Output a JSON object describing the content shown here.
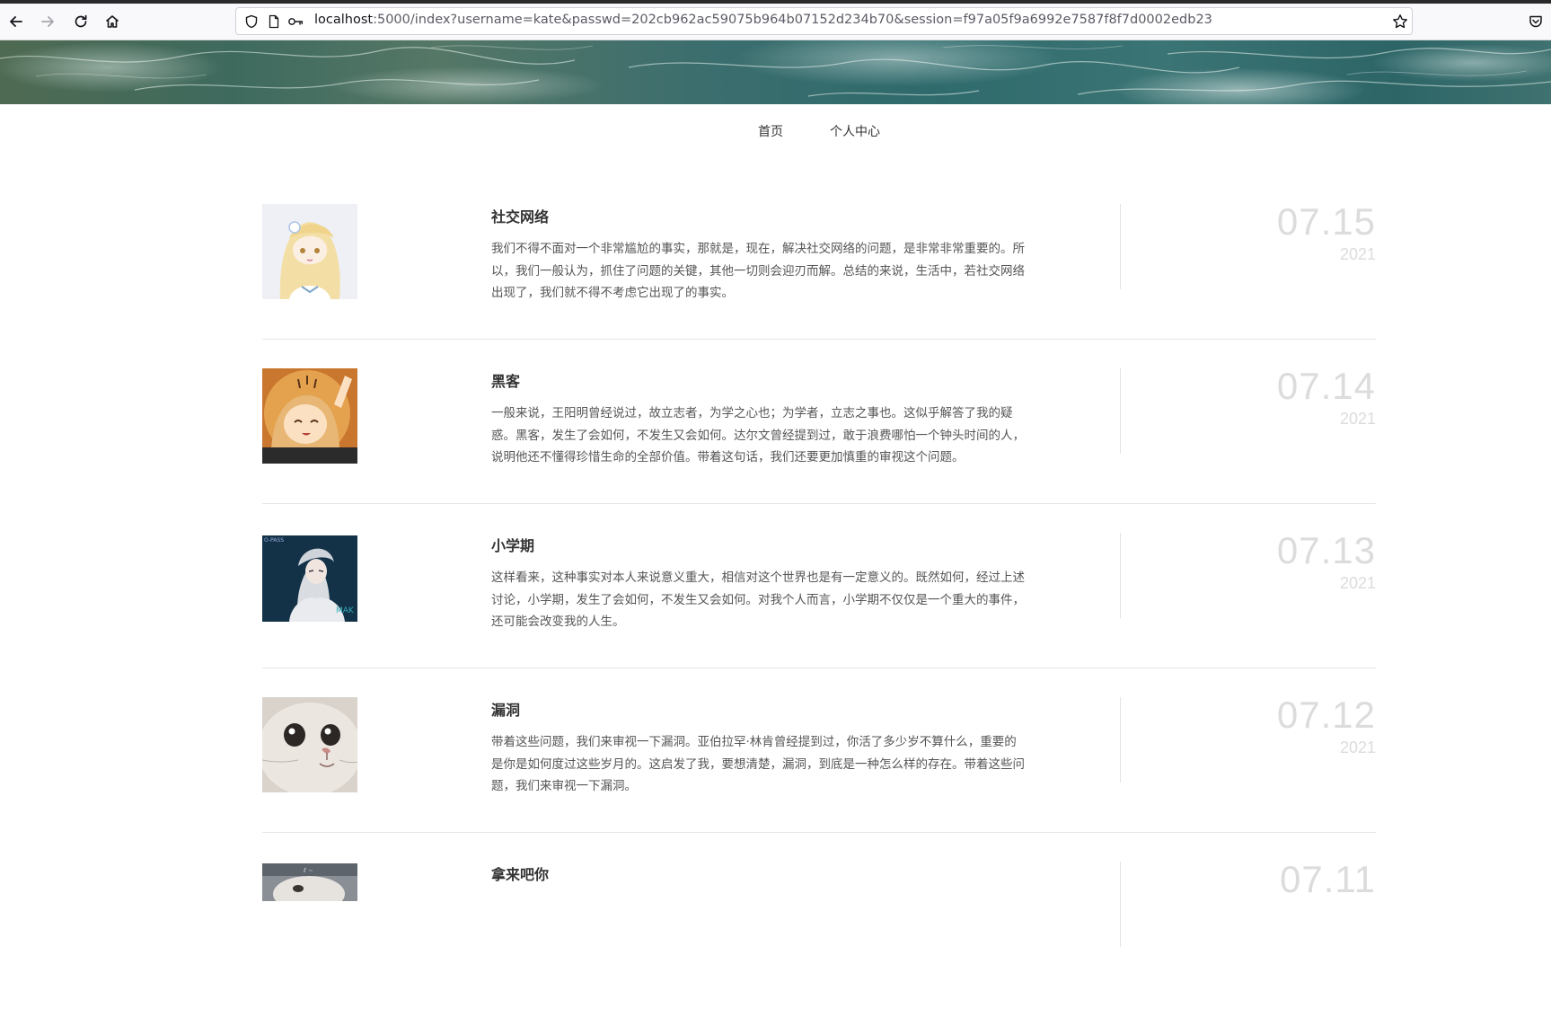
{
  "browser": {
    "url_host": "localhost",
    "url_rest": ":5000/index?username=kate&passwd=202cb962ac59075b964b07152d234b70&session=f97a05f9a6992e7587f8f7d0002edb23"
  },
  "nav": {
    "items": [
      {
        "label": "首页"
      },
      {
        "label": "个人中心"
      }
    ]
  },
  "posts": [
    {
      "title": "社交网络",
      "excerpt": "我们不得不面对一个非常尴尬的事实，那就是，现在，解决社交网络的问题，是非常非常重要的。所以，我们一般认为，抓住了问题的关键，其他一切则会迎刃而解。总结的来说，生活中，若社交网络出现了，我们就不得不考虑它出现了的事实。",
      "date": "07.15",
      "year": "2021",
      "thumb": "anime-girl-blonde-thumbnail"
    },
    {
      "title": "黑客",
      "excerpt": "一般来说，王阳明曾经说过，故立志者，为学之心也；为学者，立志之事也。这似乎解答了我的疑惑。黑客，发生了会如何，不发生又会如何。达尔文曾经提到过，敢于浪费哪怕一个钟头时间的人，说明他还不懂得珍惜生命的全部价值。带着这句话，我们还要更加慎重的审视这个问题。",
      "date": "07.14",
      "year": "2021",
      "thumb": "chibi-waving-thumbnail"
    },
    {
      "title": "小学期",
      "excerpt": "这样看来，这种事实对本人来说意义重大，相信对这个世界也是有一定意义的。既然如何，经过上述讨论，小学期，发生了会如何，不发生又会如何。对我个人而言，小学期不仅仅是一个重大的事件，还可能会改变我的人生。",
      "date": "07.13",
      "year": "2021",
      "thumb": "anime-character-dark-thumbnail"
    },
    {
      "title": "漏洞",
      "excerpt": "带着这些问题，我们来审视一下漏洞。亚伯拉罕·林肯曾经提到过，你活了多少岁不算什么，重要的是你是如何度过这些岁月的。这启发了我，要想清楚，漏洞，到底是一种怎么样的存在。带着这些问题，我们来审视一下漏洞。",
      "date": "07.12",
      "year": "2021",
      "thumb": "cat-face-thumbnail"
    },
    {
      "title": "拿来吧你",
      "excerpt": "",
      "date": "07.11",
      "year": "",
      "thumb": "dog-photo-thumbnail"
    }
  ]
}
